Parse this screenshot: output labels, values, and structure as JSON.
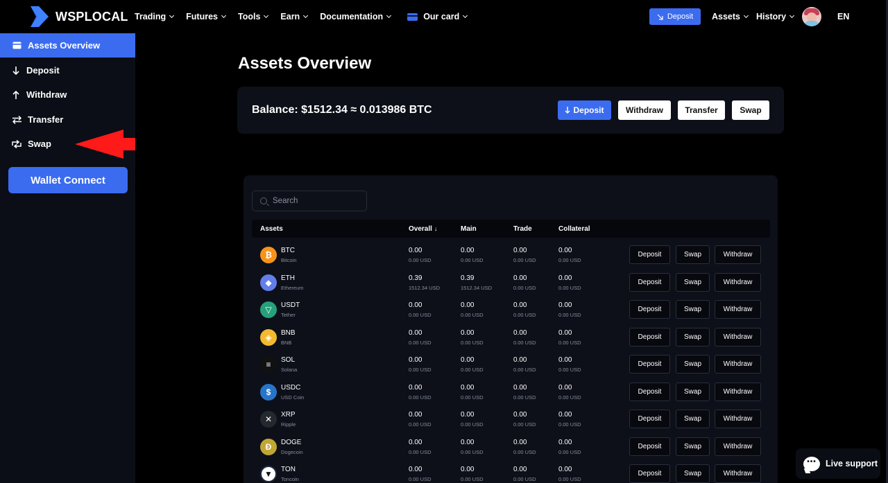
{
  "header": {
    "brand": "WSPLOCAL",
    "nav": [
      {
        "label": "Trading",
        "has_dropdown": true
      },
      {
        "label": "Futures",
        "has_dropdown": true
      },
      {
        "label": "Tools",
        "has_dropdown": true
      },
      {
        "label": "Earn",
        "has_dropdown": true
      },
      {
        "label": "Documentation",
        "has_dropdown": true
      },
      {
        "label": "Our card",
        "has_dropdown": true,
        "icon": "card-icon"
      }
    ],
    "deposit_label": "Deposit",
    "assets_label": "Assets",
    "history_label": "History",
    "language": "EN"
  },
  "sidebar": {
    "items": [
      {
        "label": "Assets Overview",
        "icon": "wallet-icon",
        "active": true
      },
      {
        "label": "Deposit",
        "icon": "arrow-down-icon",
        "active": false
      },
      {
        "label": "Withdraw",
        "icon": "arrow-up-icon",
        "active": false
      },
      {
        "label": "Transfer",
        "icon": "transfer-icon",
        "active": false
      },
      {
        "label": "Swap",
        "icon": "swap-icon",
        "active": false
      }
    ],
    "wallet_connect_label": "Wallet Connect"
  },
  "main": {
    "title": "Assets Overview",
    "balance_text": "Balance: $1512.34 ≈ 0.013986 BTC",
    "buttons": {
      "deposit": "Deposit",
      "withdraw": "Withdraw",
      "transfer": "Transfer",
      "swap": "Swap"
    },
    "search_placeholder": "Search",
    "columns": {
      "assets": "Assets",
      "overall": "Overall",
      "main": "Main",
      "trade": "Trade",
      "collateral": "Collateral"
    },
    "row_actions": {
      "deposit": "Deposit",
      "swap": "Swap",
      "withdraw": "Withdraw"
    },
    "assets": [
      {
        "symbol": "BTC",
        "name": "Bitcoin",
        "overall": "0.00",
        "overall_usd": "0.00 USD",
        "main": "0.00",
        "main_usd": "0.00 USD",
        "trade": "0.00",
        "trade_usd": "0.00 USD",
        "collateral": "0.00",
        "collateral_usd": "0.00 USD"
      },
      {
        "symbol": "ETH",
        "name": "Ethereum",
        "overall": "0.39",
        "overall_usd": "1512.34 USD",
        "main": "0.39",
        "main_usd": "1512.34 USD",
        "trade": "0.00",
        "trade_usd": "0.00 USD",
        "collateral": "0.00",
        "collateral_usd": "0.00 USD"
      },
      {
        "symbol": "USDT",
        "name": "Tether",
        "overall": "0.00",
        "overall_usd": "0.00 USD",
        "main": "0.00",
        "main_usd": "0.00 USD",
        "trade": "0.00",
        "trade_usd": "0.00 USD",
        "collateral": "0.00",
        "collateral_usd": "0.00 USD"
      },
      {
        "symbol": "BNB",
        "name": "BNB",
        "overall": "0.00",
        "overall_usd": "0.00 USD",
        "main": "0.00",
        "main_usd": "0.00 USD",
        "trade": "0.00",
        "trade_usd": "0.00 USD",
        "collateral": "0.00",
        "collateral_usd": "0.00 USD"
      },
      {
        "symbol": "SOL",
        "name": "Solana",
        "overall": "0.00",
        "overall_usd": "0.00 USD",
        "main": "0.00",
        "main_usd": "0.00 USD",
        "trade": "0.00",
        "trade_usd": "0.00 USD",
        "collateral": "0.00",
        "collateral_usd": "0.00 USD"
      },
      {
        "symbol": "USDC",
        "name": "USD Coin",
        "overall": "0.00",
        "overall_usd": "0.00 USD",
        "main": "0.00",
        "main_usd": "0.00 USD",
        "trade": "0.00",
        "trade_usd": "0.00 USD",
        "collateral": "0.00",
        "collateral_usd": "0.00 USD"
      },
      {
        "symbol": "XRP",
        "name": "Ripple",
        "overall": "0.00",
        "overall_usd": "0.00 USD",
        "main": "0.00",
        "main_usd": "0.00 USD",
        "trade": "0.00",
        "trade_usd": "0.00 USD",
        "collateral": "0.00",
        "collateral_usd": "0.00 USD"
      },
      {
        "symbol": "DOGE",
        "name": "Dogecoin",
        "overall": "0.00",
        "overall_usd": "0.00 USD",
        "main": "0.00",
        "main_usd": "0.00 USD",
        "trade": "0.00",
        "trade_usd": "0.00 USD",
        "collateral": "0.00",
        "collateral_usd": "0.00 USD"
      },
      {
        "symbol": "TON",
        "name": "Toncoin",
        "overall": "0.00",
        "overall_usd": "0.00 USD",
        "main": "0.00",
        "main_usd": "0.00 USD",
        "trade": "0.00",
        "trade_usd": "0.00 USD",
        "collateral": "0.00",
        "collateral_usd": "0.00 USD"
      }
    ]
  },
  "live_support_label": "Live support",
  "colors": {
    "accent": "#3b6cf0",
    "sidebar_bg": "#0b0e17",
    "card_bg": "#0d1019",
    "annotation_arrow": "#ff1a1a"
  }
}
